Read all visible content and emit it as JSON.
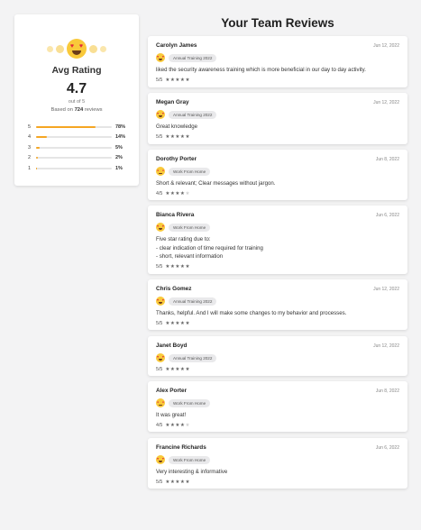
{
  "summary": {
    "title": "Avg Rating",
    "value": "4.7",
    "out_of": "out of 5",
    "based_prefix": "Based on",
    "review_count": "724",
    "based_suffix": "reviews",
    "distribution": [
      {
        "star": "5",
        "pct": "78%",
        "fraction": 0.78
      },
      {
        "star": "4",
        "pct": "14%",
        "fraction": 0.14
      },
      {
        "star": "3",
        "pct": "5%",
        "fraction": 0.05
      },
      {
        "star": "2",
        "pct": "2%",
        "fraction": 0.02
      },
      {
        "star": "1",
        "pct": "1%",
        "fraction": 0.01
      }
    ],
    "bar_color": "#f5a623"
  },
  "page": {
    "title": "Your Team Reviews"
  },
  "reviews": [
    {
      "name": "Carolyn James",
      "date": "Jun 12, 2022",
      "tag": "Annual Training 2022",
      "mood": "love",
      "text": "liked the security awareness training which is more beneficial in our day to day activity.",
      "score_label": "5/5",
      "stars": 5
    },
    {
      "name": "Megan Gray",
      "date": "Jun 12, 2022",
      "tag": "Annual Training 2022",
      "mood": "love",
      "text": "Great knowledge",
      "score_label": "5/5",
      "stars": 5
    },
    {
      "name": "Dorothy Porter",
      "date": "Jun 8, 2022",
      "tag": "Work From Home",
      "mood": "smile",
      "text": "Short & relevant; Clear messages without jargon.",
      "score_label": "4/5",
      "stars": 4
    },
    {
      "name": "Bianca Rivera",
      "date": "Jun 6, 2022",
      "tag": "Work From Home",
      "mood": "love",
      "text": "Five star rating due to:\n- clear indication of time required for training\n- short, relevant information",
      "score_label": "5/5",
      "stars": 5
    },
    {
      "name": "Chris Gomez",
      "date": "Jun 12, 2022",
      "tag": "Annual Training 2022",
      "mood": "love",
      "text": "Thanks, helpful. And I will make some changes to my behavior and processes.",
      "score_label": "5/5",
      "stars": 5
    },
    {
      "name": "Janet Boyd",
      "date": "Jun 12, 2022",
      "tag": "Annual Training 2022",
      "mood": "love",
      "text": "",
      "score_label": "5/5",
      "stars": 5
    },
    {
      "name": "Alex Porter",
      "date": "Jun 8, 2022",
      "tag": "Work From Home",
      "mood": "smile",
      "text": "It was great!",
      "score_label": "4/5",
      "stars": 4
    },
    {
      "name": "Francine Richards",
      "date": "Jun 6, 2022",
      "tag": "Work From Home",
      "mood": "love",
      "text": "Very interesting & informative",
      "score_label": "5/5",
      "stars": 5
    }
  ]
}
